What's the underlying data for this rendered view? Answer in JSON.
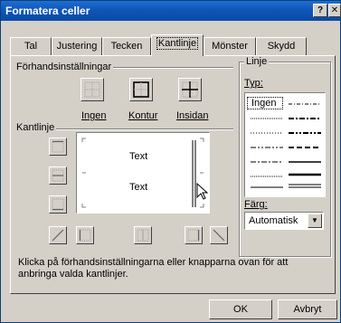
{
  "window": {
    "title": "Formatera celler",
    "help_label": "?",
    "close_label": "✕"
  },
  "tabs": [
    {
      "label": "Tal",
      "active": false
    },
    {
      "label": "Justering",
      "active": false
    },
    {
      "label": "Tecken",
      "active": false
    },
    {
      "label": "Kantlinje",
      "active": true
    },
    {
      "label": "Mönster",
      "active": false
    },
    {
      "label": "Skydd",
      "active": false
    }
  ],
  "presets": {
    "group_title": "Förhandsinställningar",
    "items": [
      {
        "label": "Ingen",
        "icon": "no-border-icon"
      },
      {
        "label": "Kontur",
        "icon": "outline-border-icon"
      },
      {
        "label": "Insidan",
        "icon": "inside-border-icon"
      }
    ]
  },
  "border": {
    "group_title": "Kantlinje",
    "preview_text_top": "Text",
    "preview_text_bottom": "Text"
  },
  "line": {
    "group_title": "Linje",
    "type_label": "Typ:",
    "none_label": "Ingen",
    "color_label": "Färg:",
    "color_value": "Automatisk"
  },
  "hint": "Klicka på förhandsinställningarna eller knapparna ovan för att anbringa valda kantlinjer.",
  "buttons": {
    "ok": "OK",
    "cancel": "Avbryt"
  }
}
